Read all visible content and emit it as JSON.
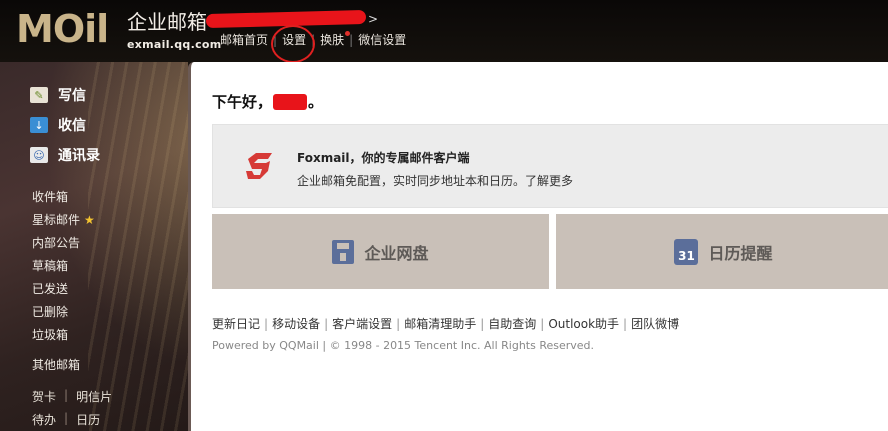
{
  "header": {
    "logo_text": "MOil",
    "brand_title": "企业邮箱",
    "brand_domain": "exmail.qq.com",
    "arrow": ">",
    "nav": [
      "邮箱首页",
      "设置",
      "换肤",
      "微信设置"
    ]
  },
  "sidebar": {
    "actions": [
      {
        "label": "写信",
        "icon": "write-icon"
      },
      {
        "label": "收信",
        "icon": "inbox-download-icon"
      },
      {
        "label": "通讯录",
        "icon": "contacts-icon"
      }
    ],
    "folders": [
      "收件箱",
      "星标邮件",
      "内部公告",
      "草稿箱",
      "已发送",
      "已删除",
      "垃圾箱"
    ],
    "other_mail": "其他邮箱",
    "bottom_row1": [
      "贺卡",
      "明信片"
    ],
    "bottom_row2": [
      "待办",
      "日历"
    ]
  },
  "main": {
    "greeting_prefix": "下午好，",
    "greeting_suffix": "。",
    "promo": {
      "title": "Foxmail，你的专属邮件客户端",
      "desc": "企业邮箱免配置，实时同步地址本和日历。",
      "link": "了解更多"
    },
    "tiles": [
      {
        "label": "企业网盘",
        "icon": "disk-icon"
      },
      {
        "label": "日历提醒",
        "icon": "calendar-icon",
        "icon_text": "31"
      }
    ],
    "footer_links": [
      "更新日记",
      "移动设备",
      "客户端设置",
      "邮箱清理助手",
      "自助查询",
      "Outlook助手",
      "团队微博"
    ],
    "copyright": "Powered by QQMail  | © 1998 - 2015 Tencent Inc. All Rights Reserved."
  }
}
